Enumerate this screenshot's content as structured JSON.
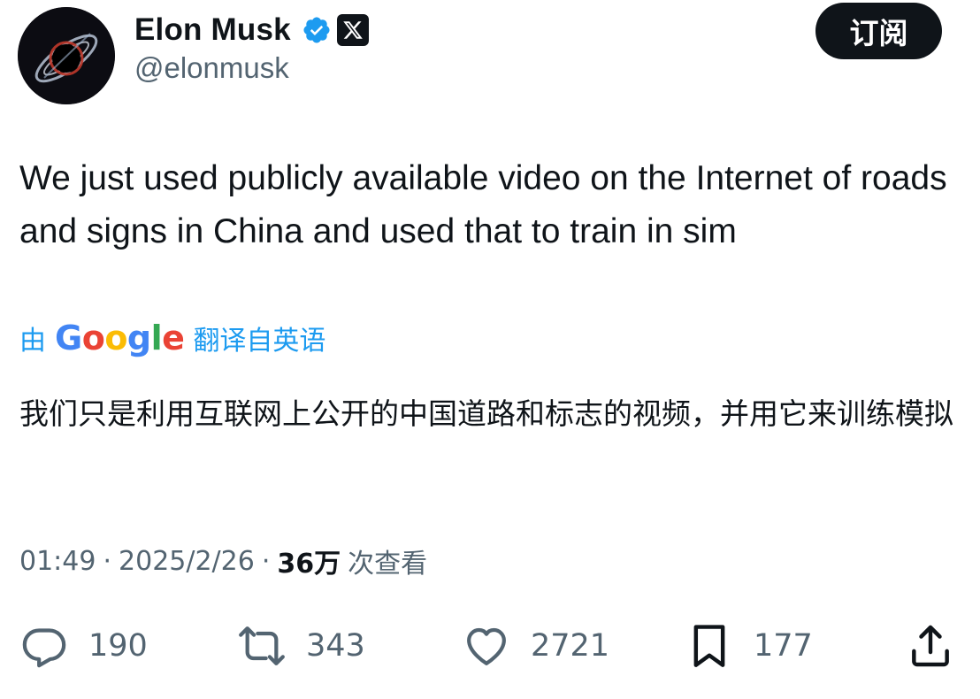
{
  "author": {
    "display_name": "Elon Musk",
    "handle": "@elonmusk",
    "verified_badge": "verified-check-icon",
    "affiliation_badge": "x-logo-icon",
    "avatar": "avatar-image"
  },
  "header": {
    "subscribe_label": "订阅"
  },
  "tweet": {
    "text": "We just used publicly available video on the Internet of roads and signs in China and used that to train in sim",
    "translation": {
      "prefix": "由",
      "provider": "Google",
      "suffix": "翻译自英语",
      "text": "我们只是利用互联网上公开的中国道路和标志的视频，并用它来训练模拟"
    },
    "meta": {
      "time": "01:49",
      "date": "2025/2/26",
      "views": "36万",
      "views_label": "次查看",
      "separator": "·"
    }
  },
  "actions": {
    "reply": {
      "icon": "reply-icon",
      "count": "190"
    },
    "repost": {
      "icon": "repost-icon",
      "count": "343"
    },
    "like": {
      "icon": "heart-icon",
      "count": "2721"
    },
    "bookmark": {
      "icon": "bookmark-icon",
      "count": "177"
    },
    "share": {
      "icon": "share-icon"
    }
  },
  "colors": {
    "text_primary": "#0f1419",
    "text_secondary": "#536471",
    "link_blue": "#1d9bf0",
    "verified_blue": "#1d9bf0",
    "button_bg": "#0f1419"
  }
}
